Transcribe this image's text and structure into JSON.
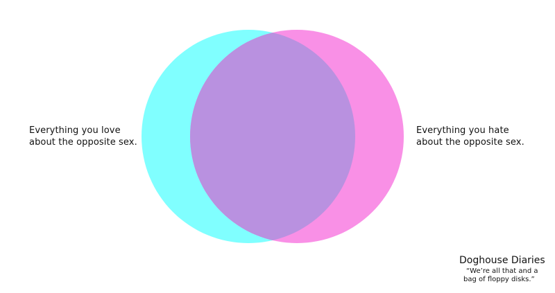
{
  "diagram": {
    "left_label": [
      "Everything you love",
      "about the opposite sex."
    ],
    "right_label": [
      "Everything you hate",
      "about the opposite sex."
    ],
    "colors": {
      "left_circle": "#80ffff",
      "right_circle": "#f990e6",
      "overlap": "#b991e0"
    }
  },
  "credit": {
    "title": "Doghouse Diaries",
    "tagline": [
      "“We’re all that and a",
      "bag of floppy disks.”"
    ]
  }
}
